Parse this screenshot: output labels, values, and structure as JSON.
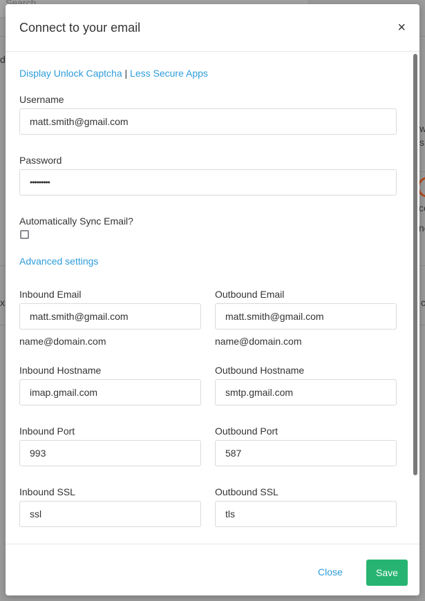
{
  "background": {
    "search_placeholder": "Search",
    "fragments": [
      "d",
      "w",
      "s",
      "ce",
      "nc",
      "xi",
      "c"
    ]
  },
  "modal": {
    "title": "Connect to your email",
    "close_icon": "close-icon",
    "links": {
      "unlock_captcha": "Display Unlock Captcha",
      "separator": "|",
      "less_secure": "Less Secure Apps"
    },
    "username": {
      "label": "Username",
      "value": "matt.smith@gmail.com"
    },
    "password": {
      "label": "Password",
      "value": "•••••••••"
    },
    "auto_sync": {
      "label": "Automatically Sync Email?",
      "checked": false
    },
    "advanced_settings": "Advanced settings",
    "inbound": {
      "email": {
        "label": "Inbound Email",
        "value": "matt.smith@gmail.com",
        "help": "name@domain.com"
      },
      "hostname": {
        "label": "Inbound Hostname",
        "value": "imap.gmail.com"
      },
      "port": {
        "label": "Inbound Port",
        "value": "993"
      },
      "ssl": {
        "label": "Inbound SSL",
        "value": "ssl"
      }
    },
    "outbound": {
      "email": {
        "label": "Outbound Email",
        "value": "matt.smith@gmail.com",
        "help": "name@domain.com"
      },
      "hostname": {
        "label": "Outbound Hostname",
        "value": "smtp.gmail.com"
      },
      "port": {
        "label": "Outbound Port",
        "value": "587"
      },
      "ssl": {
        "label": "Outbound SSL",
        "value": "tls"
      }
    },
    "footer": {
      "close_label": "Close",
      "save_label": "Save"
    }
  },
  "colors": {
    "link": "#2d9cdb",
    "save_button": "#27b472"
  }
}
